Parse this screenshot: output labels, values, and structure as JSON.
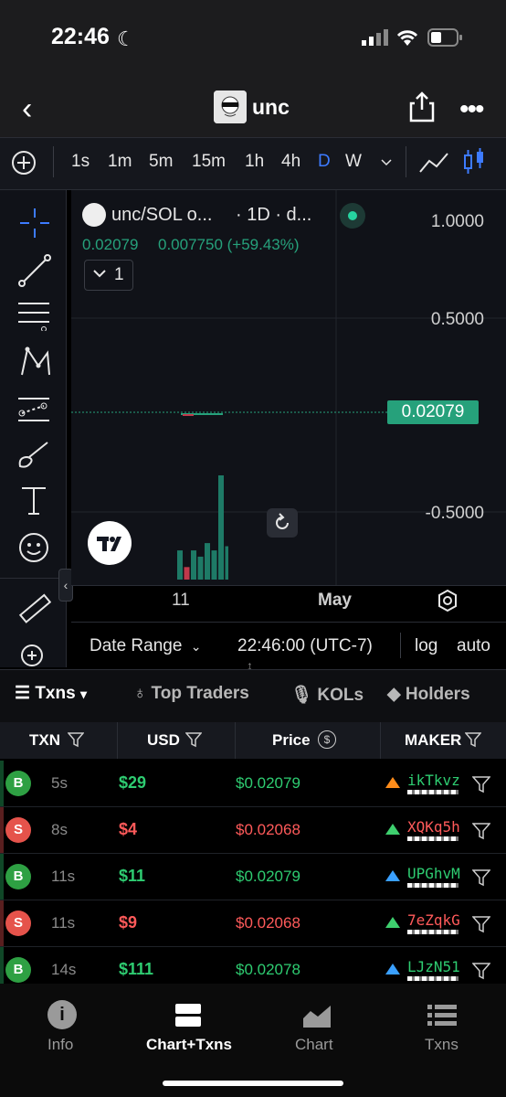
{
  "status": {
    "time": "22:46"
  },
  "header": {
    "title": "unc"
  },
  "timeframes": [
    "1s",
    "1m",
    "5m",
    "15m",
    "1h",
    "4h",
    "D",
    "W"
  ],
  "active_timeframe": "D",
  "chart": {
    "symbol": "unc/SOL o...",
    "interval": "· 1D · d...",
    "price": "0.02079",
    "change": "0.007750 (+59.43%)",
    "indicator_count": "1",
    "y_ticks": [
      "1.0000",
      "0.5000",
      "-0.5000"
    ],
    "current_price_label": "0.02079",
    "x_ticks": [
      "11",
      "May"
    ],
    "date_range_label": "Date Range",
    "clock": "22:46:00 (UTC-7)",
    "log_label": "log",
    "auto_label": "auto"
  },
  "chart_data": {
    "type": "bar",
    "title": "unc/SOL",
    "volume_bars": [
      0.28,
      0.12,
      0.28,
      0.22,
      0.35,
      0.28,
      1.0,
      0.32
    ],
    "volume_colors": [
      "#1e7a66",
      "#c0394b",
      "#1e7a66",
      "#1e7a66",
      "#1e7a66",
      "#1e7a66",
      "#1e7a66",
      "#1e7a66"
    ]
  },
  "tabs": {
    "txns": "Txns",
    "top_traders": "Top Traders",
    "kols": "KOLs",
    "holders": "Holders"
  },
  "table": {
    "headers": [
      "TXN",
      "USD",
      "Price",
      "MAKER"
    ],
    "rows": [
      {
        "type": "B",
        "age": "5s",
        "usd": "$29",
        "price": "$0.02079",
        "maker": "ikTkvz",
        "icon": "orange"
      },
      {
        "type": "S",
        "age": "8s",
        "usd": "$4",
        "price": "$0.02068",
        "maker": "XQKq5h",
        "icon": "green"
      },
      {
        "type": "B",
        "age": "11s",
        "usd": "$11",
        "price": "$0.02079",
        "maker": "UPGhvM",
        "icon": "blue"
      },
      {
        "type": "S",
        "age": "11s",
        "usd": "$9",
        "price": "$0.02068",
        "maker": "7eZqkG",
        "icon": "green"
      },
      {
        "type": "B",
        "age": "14s",
        "usd": "$111",
        "price": "$0.02078",
        "maker": "LJzN51",
        "icon": "blue"
      }
    ]
  },
  "bottom_nav": {
    "info": "Info",
    "chart_txns": "Chart+Txns",
    "chart": "Chart",
    "txns": "Txns"
  },
  "colors": {
    "buy": "#2ecc71",
    "sell": "#ff5a5a",
    "accent": "#3d7bff",
    "price_tag": "#26a17b"
  }
}
